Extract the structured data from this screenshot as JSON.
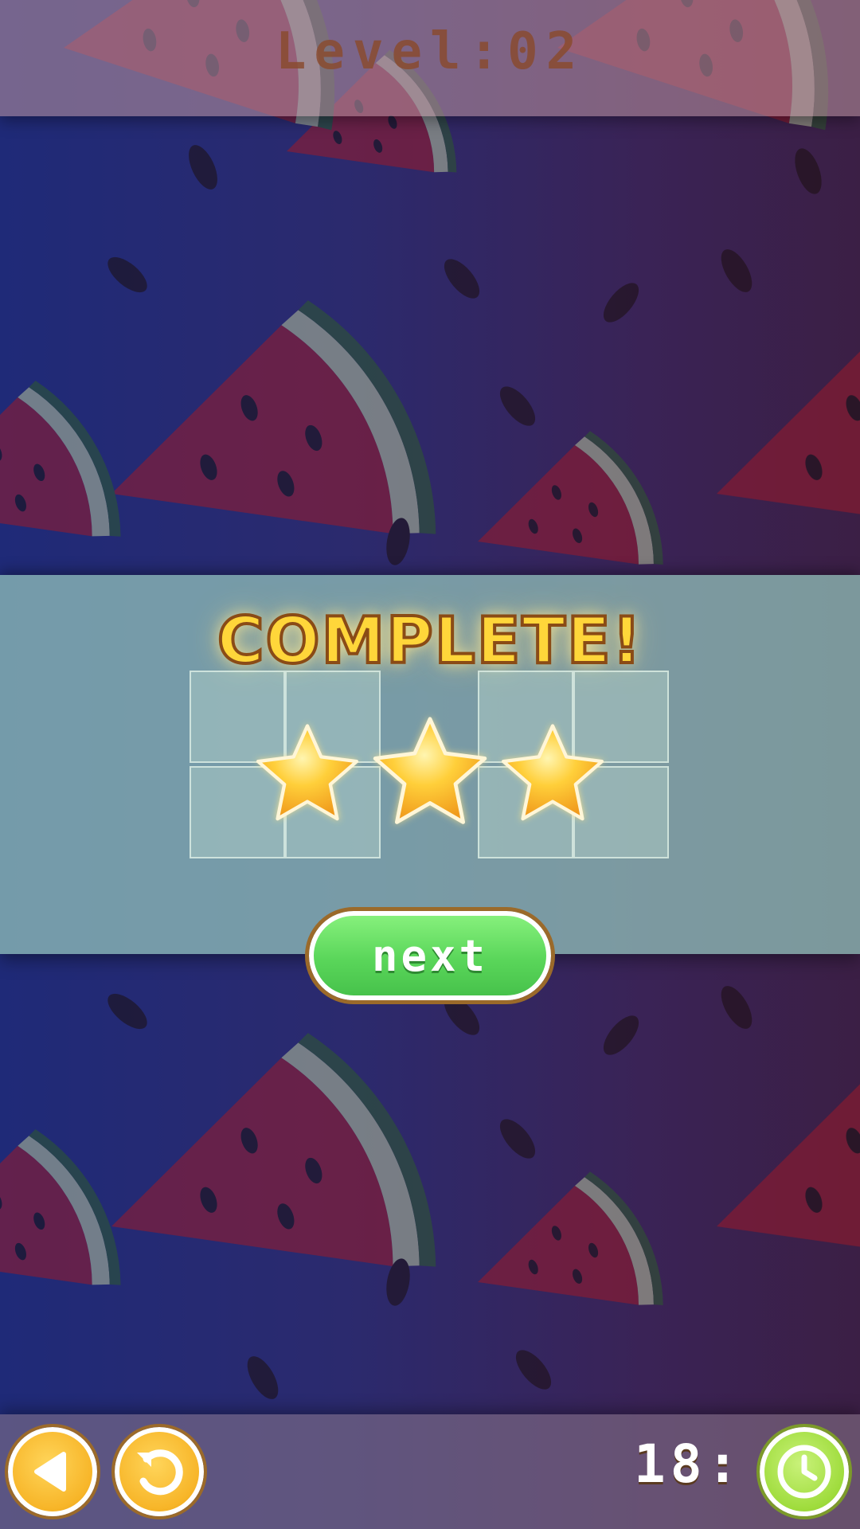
{
  "header": {
    "level_label": "Level:02"
  },
  "result": {
    "title": "COMPLETE!",
    "stars_earned": 3,
    "stars_total": 3,
    "next_label": "next"
  },
  "footer": {
    "timer": "18:",
    "back_icon": "back-arrow-icon",
    "restart_icon": "restart-icon",
    "timer_icon": "clock-icon"
  },
  "colors": {
    "accent_gold": "#ffd63a",
    "button_green": "#5ad65a",
    "button_orange": "#f7b528",
    "timer_green": "#9fdc3c"
  }
}
